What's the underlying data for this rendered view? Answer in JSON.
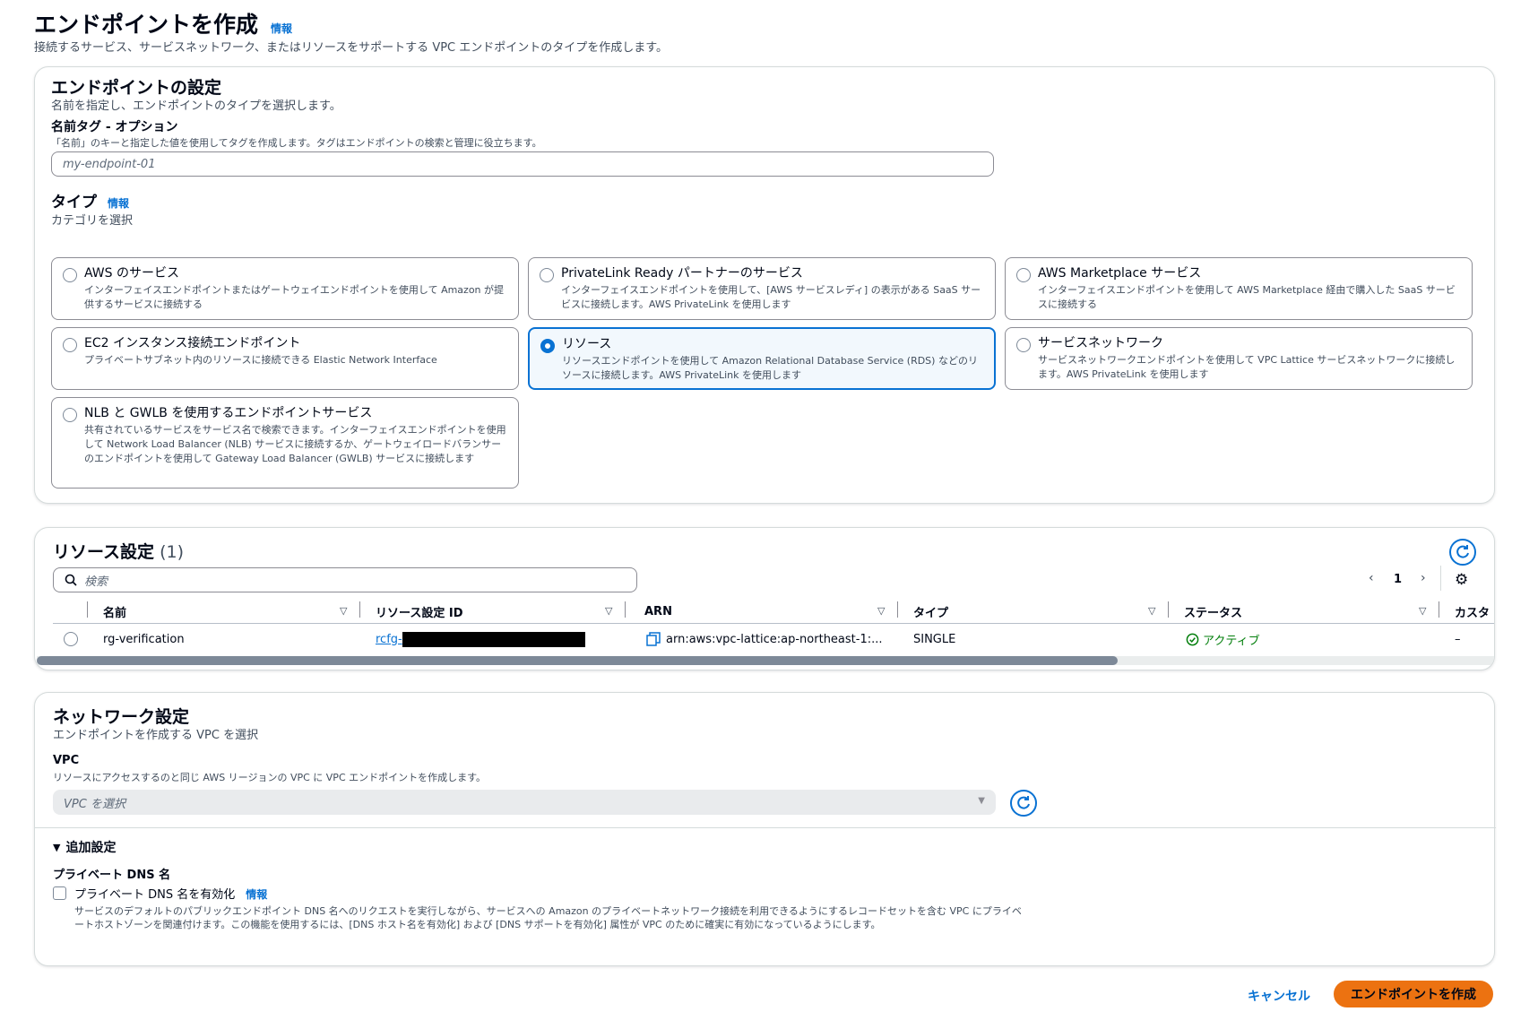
{
  "header": {
    "title": "エンドポイントを作成",
    "info": "情報",
    "description": "接続するサービス、サービスネットワーク、またはリソースをサポートする VPC エンドポイントのタイプを作成します。"
  },
  "endpoint_settings": {
    "title": "エンドポイントの設定",
    "description": "名前を指定し、エンドポイントのタイプを選択します。",
    "name_tag_label": "名前タグ - オプション",
    "name_tag_hint": "「名前」のキーと指定した値を使用してタグを作成します。タグはエンドポイントの検索と管理に役立ちます。",
    "name_tag_placeholder": "my-endpoint-01",
    "type_label": "タイプ",
    "type_info": "情報",
    "type_hint": "カテゴリを選択",
    "types": [
      {
        "title": "AWS のサービス",
        "desc": "インターフェイスエンドポイントまたはゲートウェイエンドポイントを使用して Amazon が提供するサービスに接続する",
        "selected": false
      },
      {
        "title": "PrivateLink Ready パートナーのサービス",
        "desc": "インターフェイスエンドポイントを使用して、[AWS サービスレディ] の表示がある SaaS サービスに接続します。AWS PrivateLink を使用します",
        "selected": false
      },
      {
        "title": "AWS Marketplace サービス",
        "desc": "インターフェイスエンドポイントを使用して AWS Marketplace 経由で購入した SaaS サービスに接続する",
        "selected": false
      },
      {
        "title": "EC2 インスタンス接続エンドポイント",
        "desc": "プライベートサブネット内のリソースに接続できる Elastic Network Interface",
        "selected": false
      },
      {
        "title": "リソース",
        "desc": "リソースエンドポイントを使用して Amazon Relational Database Service (RDS) などのリソースに接続します。AWS PrivateLink を使用します",
        "selected": true
      },
      {
        "title": "サービスネットワーク",
        "desc": "サービスネットワークエンドポイントを使用して VPC Lattice サービスネットワークに接続します。AWS PrivateLink を使用します",
        "selected": false
      },
      {
        "title": "NLB と GWLB を使用するエンドポイントサービス",
        "desc": "共有されているサービスをサービス名で検索できます。インターフェイスエンドポイントを使用して Network Load Balancer (NLB) サービスに接続するか、ゲートウェイロードバランサーのエンドポイントを使用して Gateway Load Balancer (GWLB) サービスに接続します",
        "selected": false
      }
    ]
  },
  "resource_settings": {
    "title": "リソース設定",
    "count": "(1)",
    "search_placeholder": "検索",
    "page": "1",
    "columns": [
      "名前",
      "リソース設定 ID",
      "ARN",
      "タイプ",
      "ステータス",
      "カスタ"
    ],
    "rows": [
      {
        "name": "rg-verification",
        "id_prefix": "rcfg-",
        "arn": "arn:aws:vpc-lattice:ap-northeast-1:...",
        "type": "SINGLE",
        "status": "アクティブ",
        "custom": "–"
      }
    ]
  },
  "network_settings": {
    "title": "ネットワーク設定",
    "description": "エンドポイントを作成する VPC を選択",
    "vpc_label": "VPC",
    "vpc_hint": "リソースにアクセスするのと同じ AWS リージョンの VPC に VPC エンドポイントを作成します。",
    "vpc_placeholder": "VPC を選択",
    "additional_settings": "追加設定",
    "private_dns_label": "プライベート DNS 名",
    "private_dns_checkbox": "プライベート DNS 名を有効化",
    "private_dns_info": "情報",
    "private_dns_desc": "サービスのデフォルトのパブリックエンドポイント DNS 名へのリクエストを実行しながら、サービスへの Amazon のプライベートネットワーク接続を利用できるようにするレコードセットを含む VPC にプライベートホストゾーンを関連付けます。この機能を使用するには、[DNS ホスト名を有効化] および [DNS サポートを有効化] 属性が VPC のために確実に有効になっているようにします。"
  },
  "footer": {
    "cancel": "キャンセル",
    "create": "エンドポイントを作成"
  },
  "colors": {
    "primary": "#0972d3",
    "accent_button": "#ec7211",
    "success": "#037f0c"
  }
}
